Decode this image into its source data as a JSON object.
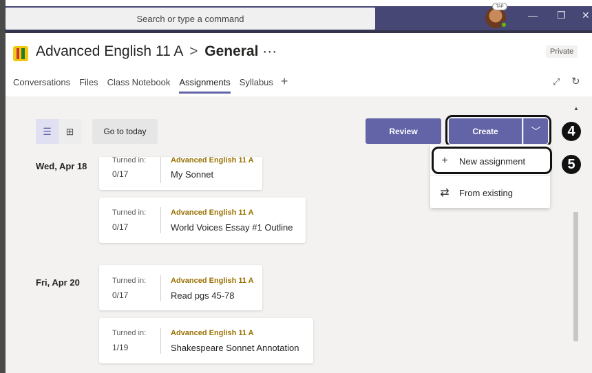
{
  "titlebar": {
    "search_placeholder": "Search or type a command",
    "avatar_badge": "TAP",
    "minimize": "—",
    "restore": "❐",
    "close": "✕"
  },
  "channel": {
    "team": "Advanced English 11 A",
    "separator": ">",
    "channel_name": "General",
    "more": "···",
    "privacy": "Private"
  },
  "tabs": [
    {
      "label": "Conversations"
    },
    {
      "label": "Files"
    },
    {
      "label": "Class Notebook"
    },
    {
      "label": "Assignments"
    },
    {
      "label": "Syllabus"
    }
  ],
  "tab_add": "+",
  "toolbar": {
    "list_view_icon": "☰",
    "grid_view_icon": "⊞",
    "go_to_today": "Go to today",
    "review": "Review",
    "create": "Create",
    "create_chevron": "﹀"
  },
  "dropdown": {
    "items": [
      {
        "icon": "plus-icon",
        "glyph": "+",
        "label": "New assignment"
      },
      {
        "icon": "copy-from-existing-icon",
        "glyph": "⇄",
        "label": "From existing"
      }
    ]
  },
  "steps": {
    "create": "4",
    "new_assignment": "5"
  },
  "schedule": [
    {
      "date": "Wed, Apr 18",
      "assignments": [
        {
          "turned_in_label": "Turned in:",
          "count": "0/17",
          "class": "Advanced English 11 A",
          "name": "My Sonnet"
        },
        {
          "turned_in_label": "Turned in:",
          "count": "0/17",
          "class": "Advanced English 11 A",
          "name": "World Voices Essay #1 Outline"
        }
      ]
    },
    {
      "date": "Fri, Apr 20",
      "assignments": [
        {
          "turned_in_label": "Turned in:",
          "count": "0/17",
          "class": "Advanced English 11 A",
          "name": "Read pgs 45-78"
        },
        {
          "turned_in_label": "Turned in:",
          "count": "1/19",
          "class": "Advanced English 11 A",
          "name": "Shakespeare Sonnet Annotation"
        }
      ]
    }
  ],
  "colors": {
    "titlebar": "#464775",
    "accent": "#6264a7",
    "class_label": "#9a7000"
  }
}
